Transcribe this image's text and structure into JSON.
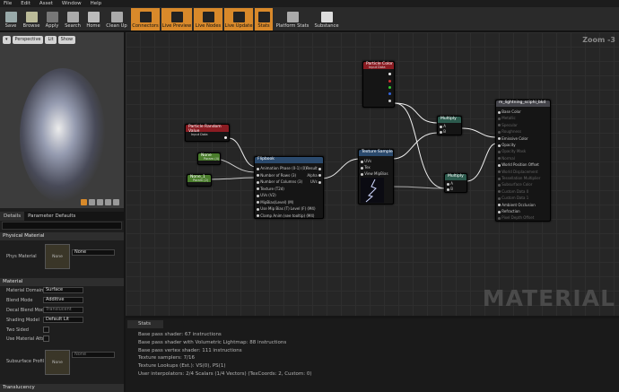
{
  "menu": [
    "File",
    "Edit",
    "Asset",
    "Window",
    "Help"
  ],
  "toolbar": [
    {
      "label": "Save",
      "icon": "save-icon",
      "on": false
    },
    {
      "label": "Browse",
      "icon": "browse-icon",
      "on": false
    },
    {
      "label": "Apply",
      "icon": "apply-icon",
      "on": false
    },
    {
      "label": "Search",
      "icon": "search-icon",
      "on": false
    },
    {
      "label": "Home",
      "icon": "home-icon",
      "on": false
    },
    {
      "label": "Clean Up",
      "icon": "cleanup-icon",
      "on": false
    },
    {
      "label": "Connectors",
      "icon": "connectors-icon",
      "on": true
    },
    {
      "label": "Live Preview",
      "icon": "live-preview-icon",
      "on": true
    },
    {
      "label": "Live Nodes",
      "icon": "live-nodes-icon",
      "on": true
    },
    {
      "label": "Live Update",
      "icon": "live-update-icon",
      "on": true
    },
    {
      "label": "Stats",
      "icon": "stats-icon",
      "on": true
    },
    {
      "label": "Platform Stats",
      "icon": "platform-stats-icon",
      "on": false
    },
    {
      "label": "Substance",
      "icon": "substance-icon",
      "on": false
    }
  ],
  "viewport": {
    "perspective": "Perspective",
    "lit": "Lit",
    "show": "Show"
  },
  "details": {
    "tabs": [
      "Details",
      "Parameter Defaults"
    ],
    "physical_section": "Physical Material",
    "phys_label": "Phys Material",
    "phys_value": "None",
    "thumb_none": "None",
    "material_section": "Material",
    "props": [
      {
        "label": "Material Domain",
        "value": "Surface"
      },
      {
        "label": "Blend Mode",
        "value": "Additive"
      },
      {
        "label": "Decal Blend Mode",
        "value": "Translucent"
      },
      {
        "label": "Shading Model",
        "value": "Default Lit"
      },
      {
        "label": "Two Sided",
        "value": ""
      },
      {
        "label": "Use Material Attri",
        "value": ""
      }
    ],
    "subsurface_label": "Subsurface Profil",
    "subsurface_value": "None",
    "translucency_section": "Translucency"
  },
  "graph": {
    "zoom": "Zoom -3",
    "watermark": "MATERIAL",
    "nodes": {
      "particle_color": {
        "title": "Particle Color",
        "sub": "Input Data"
      },
      "particle_random": {
        "title": "Particle Random Value",
        "sub": "Input Data"
      },
      "none1": {
        "title": "None",
        "sub": "Param (4)"
      },
      "none2": {
        "title": "None_1",
        "sub": "Param (2)"
      },
      "flipbook": {
        "title": "Flipbook",
        "pins_in": [
          "Animation Phase (0-1) (0)",
          "Number of Rows (3)",
          "Number of Columns (3)",
          "Texture (T2d)",
          "UVs (V2)",
          "MipBias(Level) (M)",
          "Use Mip Bias (T) Level (F) (M4)",
          "Clamp Anim (see tooltip) (M4)"
        ],
        "pins_out": [
          "Result",
          "Alpha",
          "UVs"
        ]
      },
      "texture": {
        "title": "Texture Sample",
        "pins": [
          "UVs",
          "Tex",
          "View MipBias"
        ]
      },
      "multiply1": {
        "title": "Multiply",
        "a": "A",
        "b": "B"
      },
      "multiply2": {
        "title": "Multiply",
        "a": "A",
        "b": "B"
      },
      "result": {
        "title": "m_lightning_sciphi_bkd",
        "pins": [
          "Base Color",
          "Metallic",
          "Specular",
          "Roughness",
          "Emissive Color",
          "Opacity",
          "Opacity Mask",
          "Normal",
          "World Position Offset",
          "World Displacement",
          "Tessellation Multiplier",
          "Subsurface Color",
          "Custom Data 0",
          "Custom Data 1",
          "Ambient Occlusion",
          "Refraction",
          "Pixel Depth Offset"
        ]
      }
    }
  },
  "stats": {
    "tab": "Stats",
    "lines": [
      "Base pass shader: 67 instructions",
      "Base pass shader with Volumetric Lightmap: 88 instructions",
      "Base pass vertex shader: 111 instructions",
      "Texture samplers: 7/16",
      "Texture Lookups (Est.): VS(0), PS(1)",
      "User interpolators: 2/4 Scalars (1/4 Vectors) (TexCoords: 2, Custom: 0)"
    ]
  }
}
